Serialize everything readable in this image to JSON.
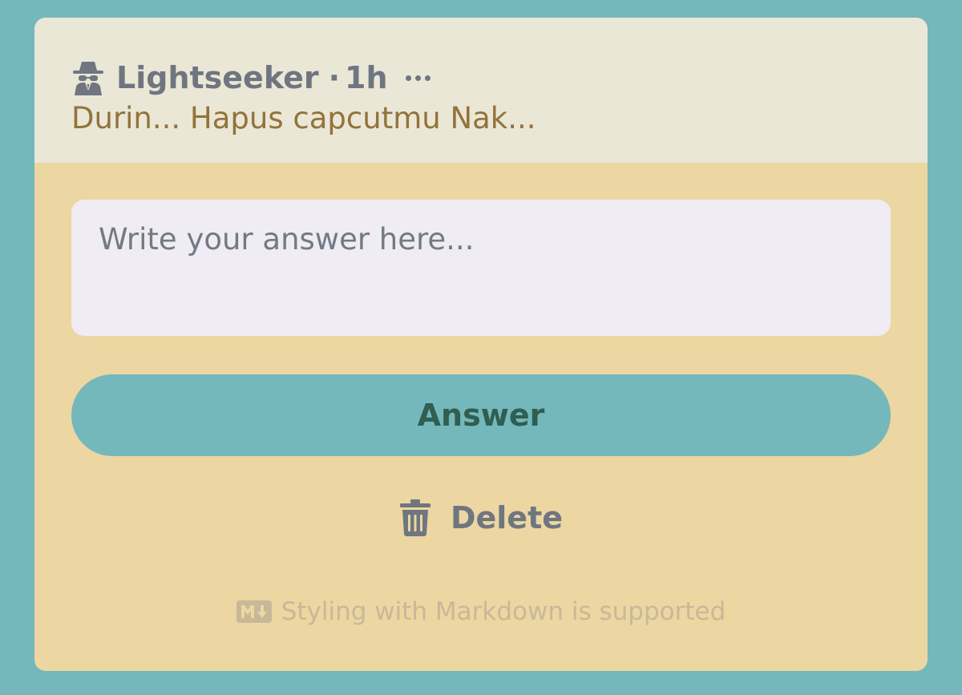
{
  "post": {
    "author": "Lightseeker",
    "separator": "·",
    "time": "1h",
    "question": "Durin... Hapus capcutmu Nak...",
    "author_icon": "spy-icon",
    "more_icon": "ellipsis-icon"
  },
  "answer_form": {
    "placeholder": "Write your answer here...",
    "value": "",
    "submit_label": "Answer",
    "delete_label": "Delete",
    "delete_icon": "trash-icon",
    "markdown_note": "Styling with Markdown is supported",
    "markdown_icon": "markdown-icon"
  },
  "colors": {
    "page_background": "#74b8bb",
    "header_background": "#eae7d7",
    "card_background": "#ecd6a2",
    "question_text": "#93733a",
    "answer_button": "#74b8bb",
    "answer_button_text": "#2f5e52",
    "muted_text": "#6f7680"
  }
}
